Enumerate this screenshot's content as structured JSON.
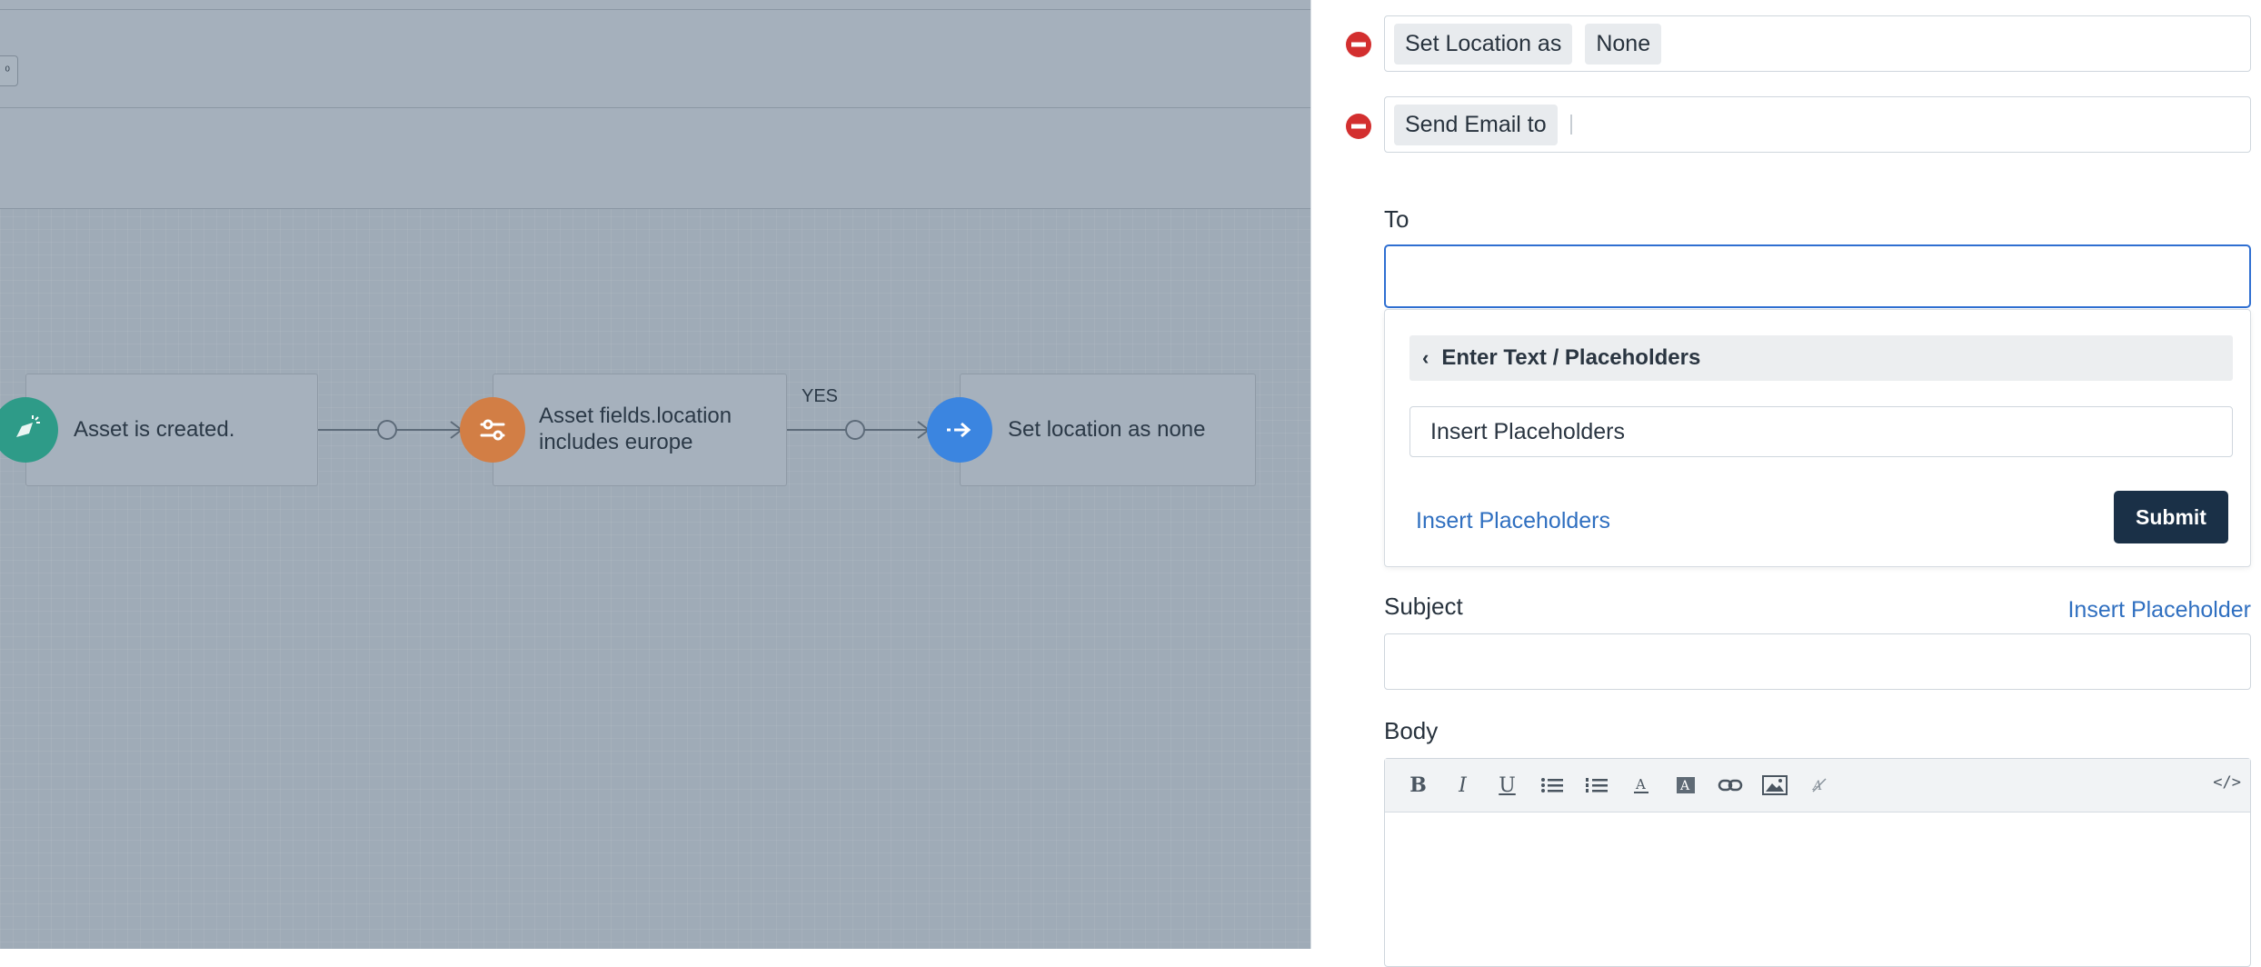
{
  "canvas": {
    "edge_button_label": "⁰",
    "nodes": [
      {
        "label": "Asset is created.",
        "icon": "cursor-click-icon",
        "color": "#2e9b88"
      },
      {
        "label": "Asset fields.location includes europe",
        "icon": "filter-sliders-icon",
        "color": "#d27e45"
      },
      {
        "label": "Set location as none",
        "icon": "arrow-right-icon",
        "color": "#3b85e0"
      }
    ],
    "branch_label": "YES"
  },
  "panel": {
    "actions": [
      {
        "chip1": "Set Location as",
        "chip2": "None"
      },
      {
        "chip1": "Send Email to",
        "chip2": ""
      }
    ],
    "to_label": "To",
    "to_value": "",
    "dropdown": {
      "header": "Enter Text / Placeholders",
      "input_value": "Insert Placeholders",
      "link": "Insert Placeholders",
      "submit": "Submit"
    },
    "subject_label": "Subject",
    "insert_placeholder": "Insert Placeholder",
    "subject_value": "",
    "body_label": "Body",
    "toolbar": [
      "bold-icon",
      "italic-icon",
      "underline-icon",
      "bullet-list-icon",
      "numbered-list-icon",
      "font-color-icon",
      "highlight-color-icon",
      "link-icon",
      "image-icon",
      "clear-format-icon",
      "code-view-icon"
    ],
    "accent": "#2f6fd1",
    "remove_color": "#d32f2f"
  }
}
